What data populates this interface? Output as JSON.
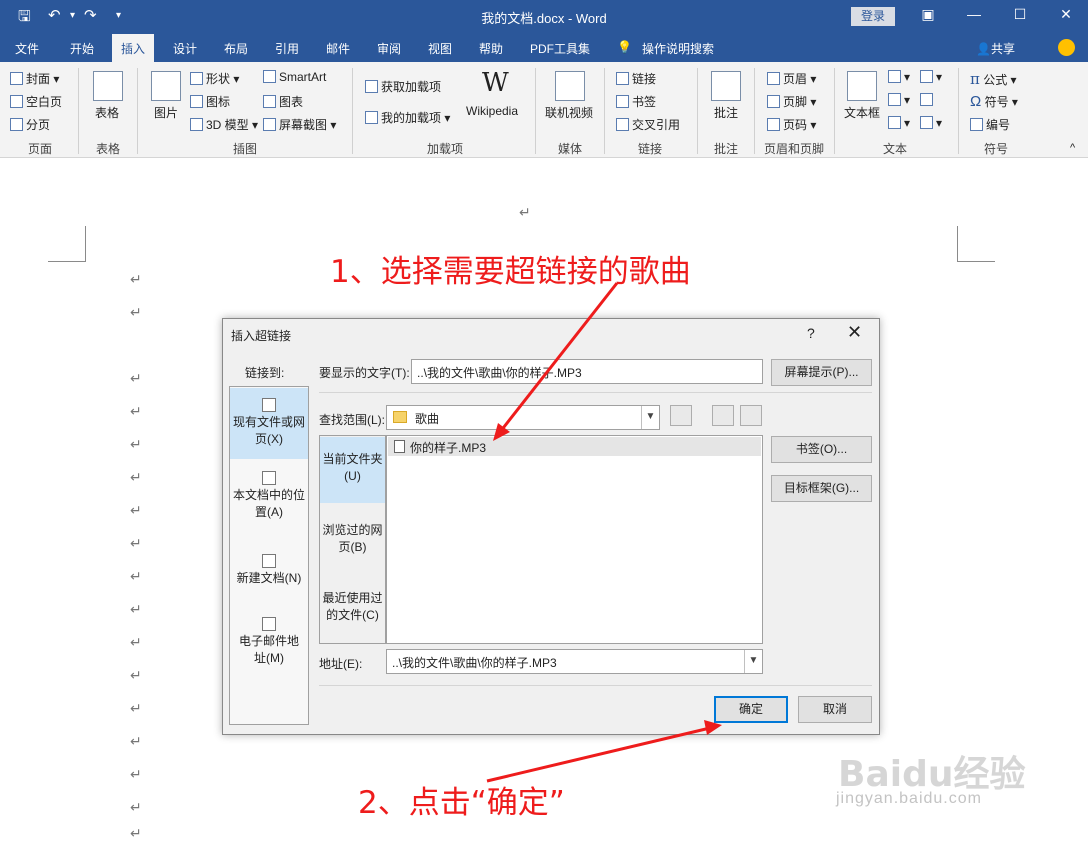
{
  "window": {
    "doc_title": "我的文档.docx  -  Word",
    "login": "登录"
  },
  "ribbon_tabs": [
    "文件",
    "开始",
    "插入",
    "设计",
    "布局",
    "引用",
    "邮件",
    "审阅",
    "视图",
    "帮助",
    "PDF工具集",
    "操作说明搜索"
  ],
  "share_label": "共享",
  "ribbon": {
    "pages": {
      "cover": "封面",
      "blank": "空白页",
      "break": "分页",
      "group": "页面"
    },
    "tables": {
      "table": "表格",
      "group": "表格"
    },
    "illustrations": {
      "picture": "图片",
      "shapes": "形状",
      "icons": "图标",
      "model3d": "3D 模型",
      "smartart": "SmartArt",
      "chart": "图表",
      "screenshot": "屏幕截图",
      "group": "插图"
    },
    "addins": {
      "get": "获取加载项",
      "mine": "我的加载项",
      "wikipedia": "Wikipedia",
      "group": "加载项"
    },
    "media": {
      "video": "联机视频",
      "group": "媒体"
    },
    "links": {
      "link": "链接",
      "bookmark": "书签",
      "crossref": "交叉引用",
      "group": "链接"
    },
    "comments": {
      "comment": "批注",
      "group": "批注"
    },
    "headerfooter": {
      "header": "页眉",
      "footer": "页脚",
      "pagenum": "页码",
      "group": "页眉和页脚"
    },
    "text": {
      "textbox": "文本框",
      "group": "文本"
    },
    "symbols": {
      "equation": "公式",
      "symbol": "符号",
      "number": "编号",
      "group": "符号"
    }
  },
  "annotations": {
    "step1": "1、选择需要超链接的歌曲",
    "step2": "2、点击“确定”"
  },
  "dialog": {
    "title": "插入超链接",
    "help": "?",
    "link_to": "链接到:",
    "link_options": [
      "现有文件或网页(X)",
      "本文档中的位置(A)",
      "新建文档(N)",
      "电子邮件地址(M)"
    ],
    "display_text_label": "要显示的文字(T):",
    "display_text": "..\\我的文件\\歌曲\\你的样子.MP3",
    "screentip_button": "屏幕提示(P)...",
    "lookin_label": "查找范围(L):",
    "lookin_value": "歌曲",
    "nav_items": [
      "当前文件夹(U)",
      "浏览过的网页(B)",
      "最近使用过的文件(C)"
    ],
    "files": [
      "你的样子.MP3"
    ],
    "bookmark_button": "书签(O)...",
    "target_button": "目标框架(G)...",
    "address_label": "地址(E):",
    "address_value": "..\\我的文件\\歌曲\\你的样子.MP3",
    "ok_button": "确定",
    "cancel_button": "取消"
  },
  "watermark": {
    "brand": "Baidu经验",
    "url": "jingyan.baidu.com"
  },
  "colors": {
    "word_blue": "#2b579a",
    "annotation_red": "#ee1c1c",
    "selection_blue": "#cce4f7"
  }
}
